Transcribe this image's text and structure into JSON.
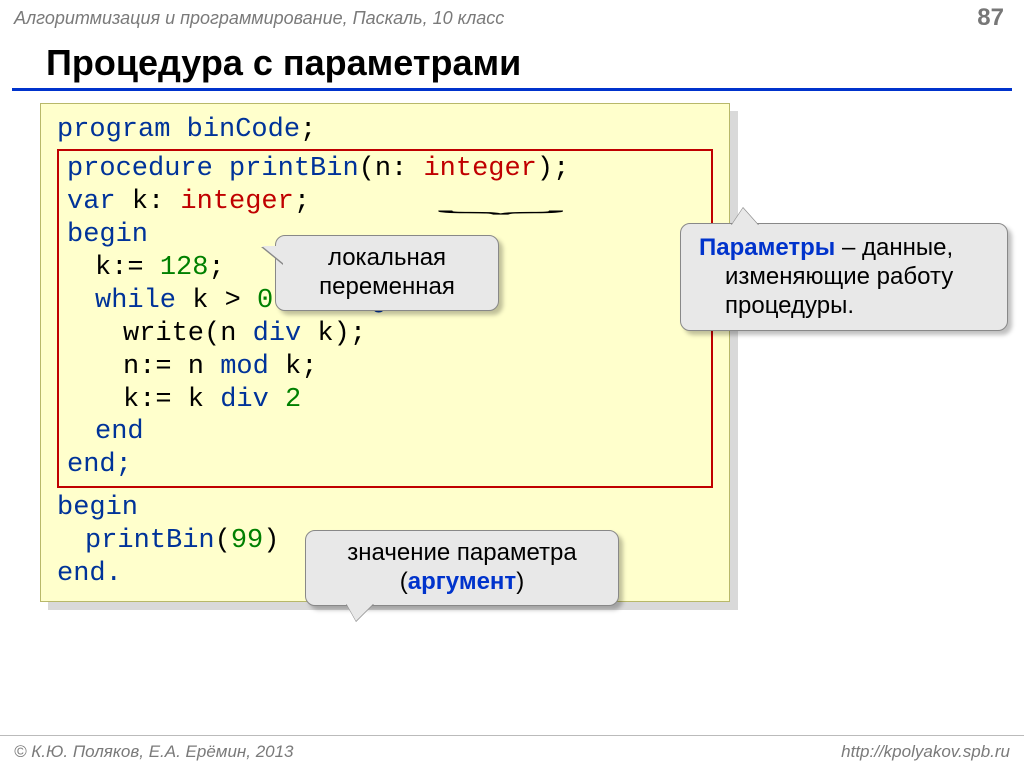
{
  "header": {
    "course": "Алгоритмизация и программирование, Паскаль, 10 класс",
    "page": "87"
  },
  "title": "Процедура с параметрами",
  "code": {
    "l01_a": "program ",
    "l01_b": "binCode",
    "l01_c": ";",
    "l02_a": "procedure ",
    "l02_b": "printBin",
    "l02_c": "(n: ",
    "l02_d": "integer",
    "l02_e": ");",
    "l03_a": "var ",
    "l03_b": "k: ",
    "l03_c": "integer",
    "l03_d": ";",
    "l04": "begin",
    "l05_a": "k:= ",
    "l05_b": "128",
    "l05_c": ";",
    "l06_a": "while ",
    "l06_b": "k > ",
    "l06_c": "0",
    "l06_d": " do begin",
    "l07_a": "write(n ",
    "l07_b": "div",
    "l07_c": " k);",
    "l08_a": "n:= n ",
    "l08_b": "mod",
    "l08_c": " k;",
    "l09_a": "k:= k ",
    "l09_b": "div",
    "l09_c": " ",
    "l09_d": "2",
    "l10": "end",
    "l11": "end;",
    "l12": "begin",
    "l13_a": "printBin",
    "l13_b": "(",
    "l13_c": "99",
    "l13_d": ")",
    "l14": "end."
  },
  "callouts": {
    "local_var": "локальная переменная",
    "params_a": "Параметры",
    "params_b": " – данные, ",
    "params_c": "изменяющие работу процедуры.",
    "arg_a": "значение параметра",
    "arg_b": "(",
    "arg_c": "аргумент",
    "arg_d": ")"
  },
  "footer": {
    "left": "© К.Ю. Поляков, Е.А. Ерёмин, 2013",
    "right": "http://kpolyakov.spb.ru"
  }
}
